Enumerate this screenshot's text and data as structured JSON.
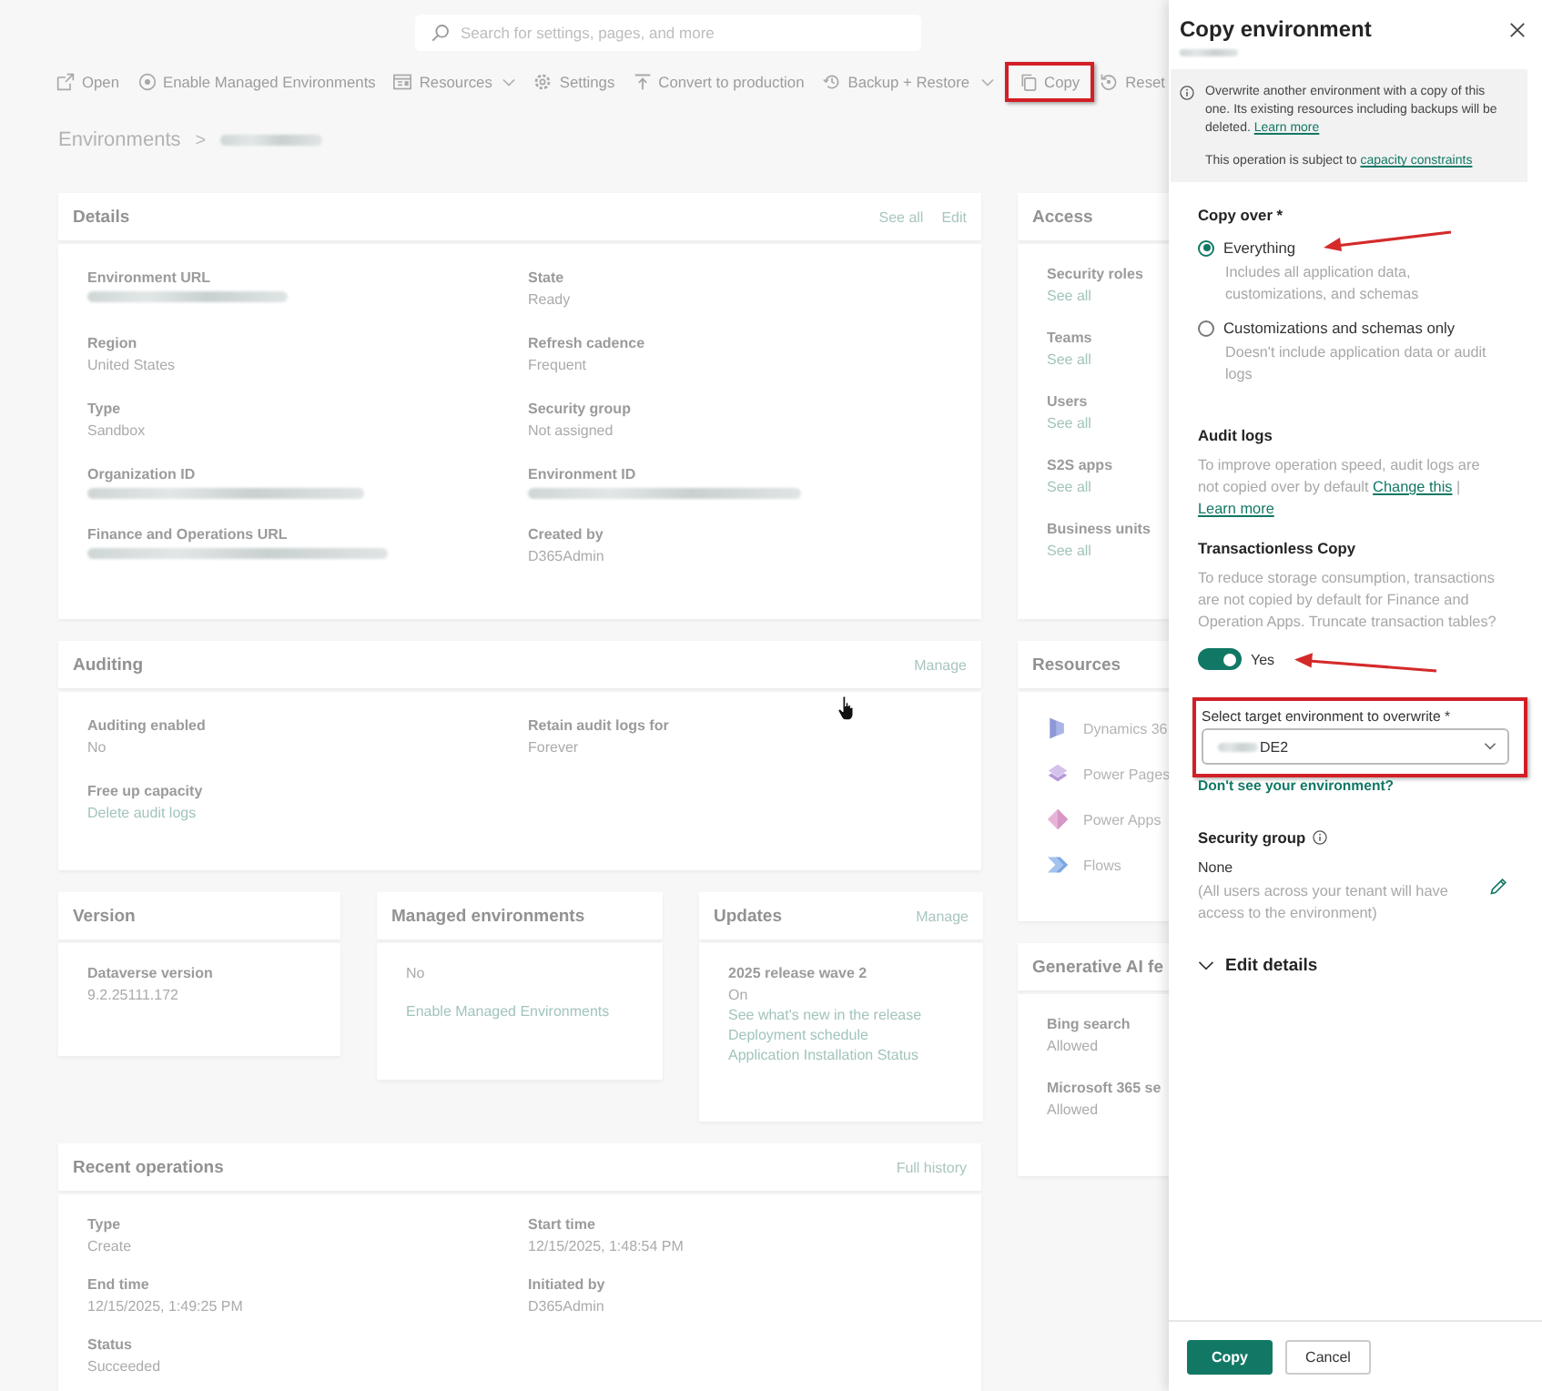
{
  "search": {
    "placeholder": "Search for settings, pages, and more"
  },
  "toolbar": [
    {
      "kind": "open",
      "label": "Open",
      "menu": false,
      "highlighted": false
    },
    {
      "kind": "managed",
      "label": "Enable Managed Environments",
      "menu": false,
      "highlighted": false
    },
    {
      "kind": "resources",
      "label": "Resources",
      "menu": true,
      "highlighted": false
    },
    {
      "kind": "settings",
      "label": "Settings",
      "menu": false,
      "highlighted": false
    },
    {
      "kind": "convert",
      "label": "Convert to production",
      "menu": false,
      "highlighted": false
    },
    {
      "kind": "backup",
      "label": "Backup + Restore",
      "menu": true,
      "highlighted": false
    },
    {
      "kind": "copy",
      "label": "Copy",
      "menu": false,
      "highlighted": true
    },
    {
      "kind": "reset",
      "label": "Reset",
      "menu": false,
      "highlighted": false
    }
  ],
  "breadcrumb": {
    "root": "Environments",
    "separator": ">",
    "current_redacted": true
  },
  "details": {
    "title": "Details",
    "actions": [
      "See all",
      "Edit"
    ],
    "fields": [
      {
        "kind": "redacted",
        "label": "Environment URL"
      },
      {
        "kind": "text",
        "label": "State",
        "value": "Ready"
      },
      {
        "kind": "text",
        "label": "Region",
        "value": "United States"
      },
      {
        "kind": "text",
        "label": "Refresh cadence",
        "value": "Frequent"
      },
      {
        "kind": "text",
        "label": "Type",
        "value": "Sandbox"
      },
      {
        "kind": "text",
        "label": "Security group",
        "value": "Not assigned"
      },
      {
        "kind": "redacted",
        "label": "Organization ID"
      },
      {
        "kind": "redacted",
        "label": "Environment ID"
      },
      {
        "kind": "redacted",
        "label": "Finance and Operations URL"
      },
      {
        "kind": "text",
        "label": "Created by",
        "value": "D365Admin"
      }
    ]
  },
  "auditing": {
    "title": "Auditing",
    "actions": [
      "Manage"
    ],
    "fields": [
      {
        "kind": "text",
        "label": "Auditing enabled",
        "value": "No"
      },
      {
        "kind": "text",
        "label": "Retain audit logs for",
        "value": "Forever"
      },
      {
        "kind": "link",
        "label": "Free up capacity",
        "value": "Delete audit logs"
      }
    ]
  },
  "cursor": {
    "kind": "hand"
  },
  "version": {
    "title": "Version",
    "fields": [
      {
        "kind": "text",
        "label": "Dataverse version",
        "value": "9.2.25111.172"
      }
    ]
  },
  "managed_environments": {
    "title": "Managed environments",
    "value": "No",
    "link": "Enable Managed Environments"
  },
  "updates": {
    "title": "Updates",
    "actions": [
      "Manage"
    ],
    "heading": "2025 release wave 2",
    "value": "On",
    "links": [
      "See what's new in the release",
      "Deployment schedule",
      "Application Installation Status"
    ]
  },
  "recent_operations": {
    "title": "Recent operations",
    "actions": [
      "Full history"
    ],
    "fields": [
      {
        "kind": "text",
        "label": "Type",
        "value": "Create"
      },
      {
        "kind": "text",
        "label": "Start time",
        "value": "12/15/2025, 1:48:54 PM"
      },
      {
        "kind": "text",
        "label": "End time",
        "value": "12/15/2025, 1:49:25 PM"
      },
      {
        "kind": "text",
        "label": "Initiated by",
        "value": "D365Admin"
      },
      {
        "kind": "text",
        "label": "Status",
        "value": "Succeeded"
      }
    ]
  },
  "access": {
    "title": "Access",
    "fields": [
      {
        "kind": "link",
        "label": "Security roles",
        "value": "See all"
      },
      {
        "kind": "link",
        "label": "Teams",
        "value": "See all"
      },
      {
        "kind": "link",
        "label": "Users",
        "value": "See all"
      },
      {
        "kind": "link",
        "label": "S2S apps",
        "value": "See all"
      },
      {
        "kind": "link",
        "label": "Business units",
        "value": "See all"
      }
    ]
  },
  "resources": {
    "title": "Resources",
    "items": [
      {
        "kind": "dynamics",
        "label": "Dynamics 36"
      },
      {
        "kind": "pages",
        "label": "Power Pages"
      },
      {
        "kind": "apps",
        "label": "Power Apps"
      },
      {
        "kind": "flows",
        "label": "Flows"
      }
    ]
  },
  "generative_ai": {
    "title": "Generative AI fe",
    "fields": [
      {
        "kind": "text",
        "label": "Bing search",
        "value": "Allowed"
      },
      {
        "kind": "text",
        "label": "Microsoft 365 se",
        "value": "Allowed"
      }
    ]
  },
  "panel": {
    "title": "Copy environment",
    "subtitle_redacted": true,
    "info": {
      "text": "Overwrite another environment with a copy of this one. Its existing resources including backups will be deleted.",
      "link": "Learn more",
      "note": "This operation is subject to",
      "note_link": "capacity constraints"
    },
    "copy_over": {
      "label": "Copy over *",
      "options": [
        {
          "label": "Everything",
          "description": "Includes all application data, customizations, and schemas",
          "selected": true,
          "arrow": true
        },
        {
          "label": "Customizations and schemas only",
          "description": "Doesn't include application data or audit logs",
          "selected": false,
          "arrow": false
        }
      ]
    },
    "audit_logs": {
      "title": "Audit logs",
      "text": "To improve operation speed, audit logs are not copied over by default",
      "links": [
        "Change this",
        "Learn more"
      ],
      "separator": "|"
    },
    "transactionless": {
      "title": "Transactionless Copy",
      "text": "To reduce storage consumption, transactions are not copied by default for Finance and Operation Apps. Truncate transaction tables?",
      "toggle": {
        "on": true,
        "label": "Yes",
        "arrow": true
      }
    },
    "target": {
      "label": "Select target environment to overwrite *",
      "value": "DE2",
      "value_prefix_redacted": true,
      "highlighted": true,
      "help_link": "Don't see your environment?"
    },
    "security_group": {
      "title": "Security group",
      "value": "None",
      "note": "(All users across your tenant will have access to the environment)"
    },
    "edit_details": {
      "label": "Edit details",
      "expanded": false
    },
    "buttons": [
      {
        "kind": "primary",
        "label": "Copy"
      },
      {
        "kind": "secondary",
        "label": "Cancel"
      }
    ]
  }
}
